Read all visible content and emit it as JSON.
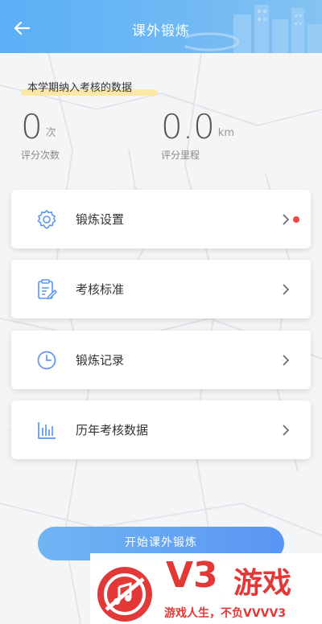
{
  "header": {
    "title": "课外锻炼"
  },
  "stats": {
    "section_label": "本学期纳入考核的数据",
    "count_value": "0",
    "count_unit": "次",
    "count_label": "评分次数",
    "distance_value": "0.0",
    "distance_unit": "km",
    "distance_label": "评分里程"
  },
  "menu": {
    "items": [
      {
        "label": "锻炼设置",
        "icon": "gear-icon",
        "has_badge": true
      },
      {
        "label": "考核标准",
        "icon": "clipboard-edit-icon",
        "has_badge": false
      },
      {
        "label": "锻炼记录",
        "icon": "clock-icon",
        "has_badge": false
      },
      {
        "label": "历年考核数据",
        "icon": "bar-chart-icon",
        "has_badge": false
      }
    ]
  },
  "actions": {
    "start_label": "开始课外锻炼"
  },
  "watermark": {
    "brand": "V3",
    "brand_suffix": "游戏",
    "slogan": "游戏人生，不负VVVV3"
  },
  "colors": {
    "header_start": "#5ab0f6",
    "accent_blue": "#5a95f3",
    "badge_red": "#f04848",
    "watermark_red": "#e23838"
  }
}
